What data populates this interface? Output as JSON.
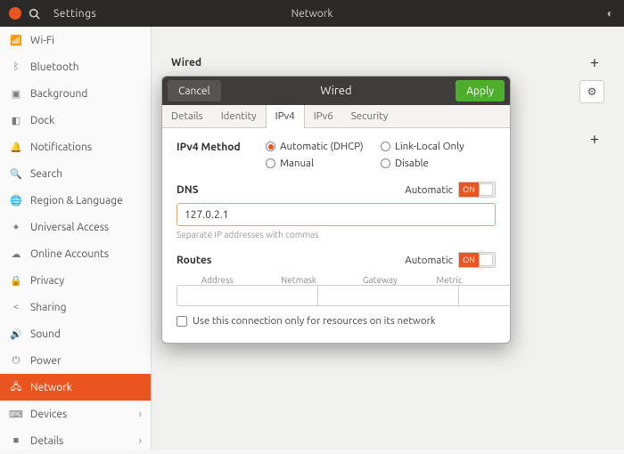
{
  "header": {
    "app": "Settings",
    "title": "Network"
  },
  "sidebar": {
    "items": [
      {
        "icon": "📶",
        "label": "Wi-Fi"
      },
      {
        "icon": "ᛒ",
        "label": "Bluetooth"
      },
      {
        "icon": "▣",
        "label": "Background"
      },
      {
        "icon": "◧",
        "label": "Dock"
      },
      {
        "icon": "🔔",
        "label": "Notifications"
      },
      {
        "icon": "🔍",
        "label": "Search"
      },
      {
        "icon": "🌐",
        "label": "Region & Language"
      },
      {
        "icon": "✦",
        "label": "Universal Access"
      },
      {
        "icon": "☁",
        "label": "Online Accounts"
      },
      {
        "icon": "🔒",
        "label": "Privacy"
      },
      {
        "icon": "<",
        "label": "Sharing"
      },
      {
        "icon": "🔊",
        "label": "Sound"
      },
      {
        "icon": "⏻",
        "label": "Power"
      },
      {
        "icon": "🖧",
        "label": "Network",
        "active": true
      },
      {
        "icon": "⌨",
        "label": "Devices",
        "chev": true
      },
      {
        "icon": "■",
        "label": "Details",
        "chev": true
      }
    ]
  },
  "content": {
    "wired_label": "Wired",
    "plus": "+",
    "vpn_plus": "+"
  },
  "dialog": {
    "cancel": "Cancel",
    "title": "Wired",
    "apply": "Apply",
    "tabs": [
      "Details",
      "Identity",
      "IPv4",
      "IPv6",
      "Security"
    ],
    "active_tab": 2,
    "method_label": "IPv4 Method",
    "methods": {
      "auto": "Automatic (DHCP)",
      "link": "Link-Local Only",
      "manual": "Manual",
      "disable": "Disable"
    },
    "dns": {
      "label": "DNS",
      "auto": "Automatic",
      "toggle": "ON",
      "value": "127.0.2.1",
      "hint": "Separate IP addresses with commas"
    },
    "routes": {
      "label": "Routes",
      "auto": "Automatic",
      "toggle": "ON",
      "cols": {
        "addr": "Address",
        "mask": "Netmask",
        "gw": "Gateway",
        "metric": "Metric"
      }
    },
    "only_net": "Use this connection only for resources on its network"
  }
}
